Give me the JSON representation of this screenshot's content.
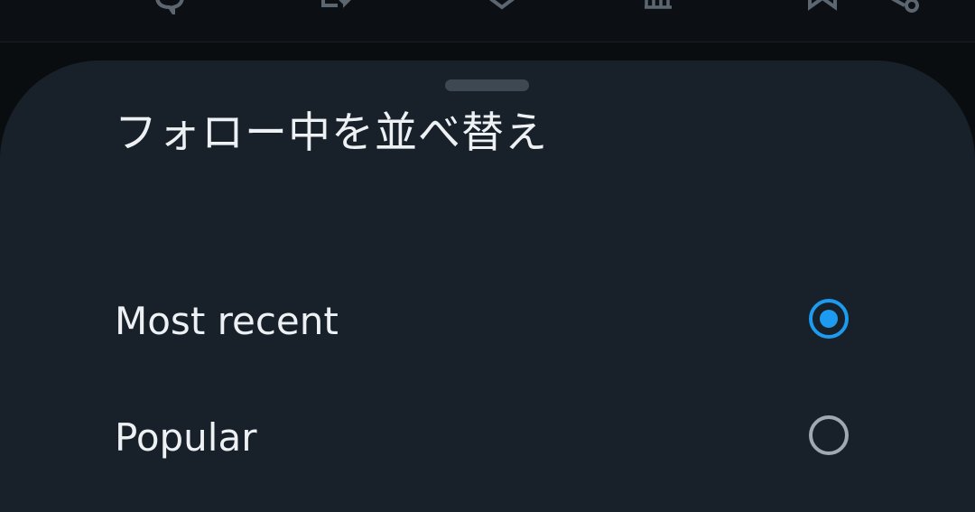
{
  "toolbar": {
    "icons": [
      "reply-icon",
      "repost-icon",
      "like-icon",
      "views-icon",
      "bookmark-icon",
      "share-icon"
    ]
  },
  "sheet": {
    "title": "フォロー中を並べ替え",
    "options": [
      {
        "label": "Most recent",
        "selected": true
      },
      {
        "label": "Popular",
        "selected": false
      }
    ]
  },
  "colors": {
    "accent": "#1d9bf0",
    "sheet_bg": "#18202a",
    "text": "#eef1f4"
  }
}
